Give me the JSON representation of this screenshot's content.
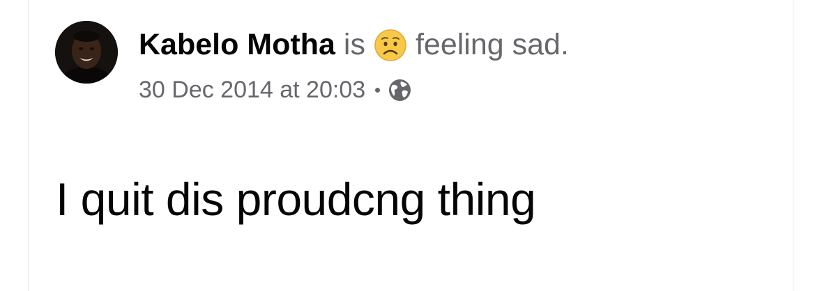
{
  "post": {
    "author_name": "Kabelo Motha",
    "activity_verb": "is",
    "feeling_text": "feeling sad.",
    "feeling_icon": "sad-face-emoji-icon",
    "timestamp": "30 Dec 2014 at 20:03",
    "audience_icon": "globe-icon",
    "body_text": "I quit dis proudcng thing"
  },
  "colors": {
    "author_text": "#050505",
    "secondary_text": "#65676b",
    "card_border": "#e4e6eb",
    "emoji_face": "#f7c948"
  }
}
